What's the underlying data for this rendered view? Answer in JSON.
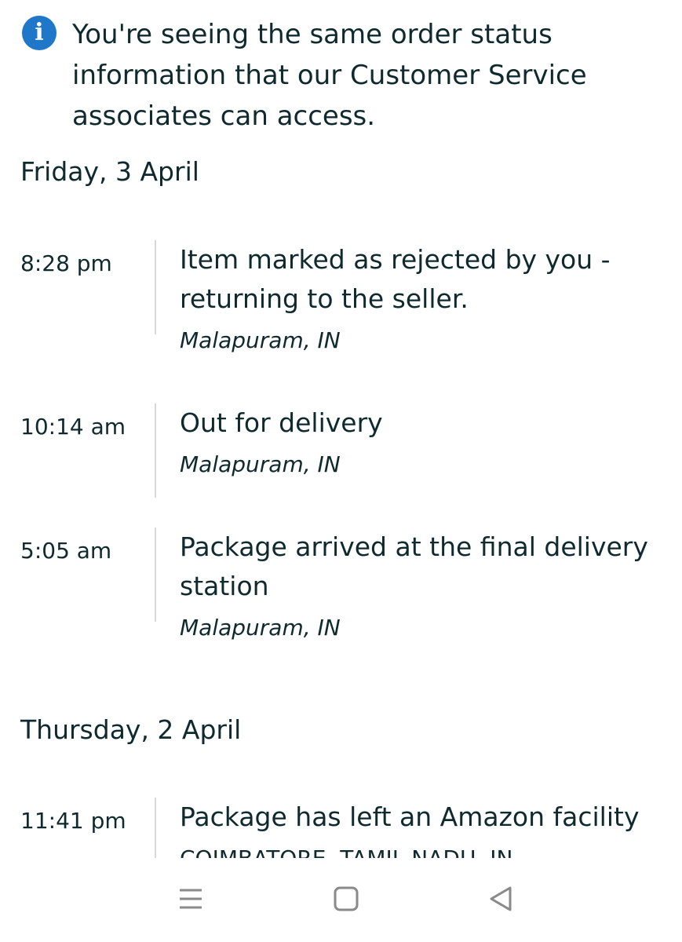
{
  "notice": {
    "icon": "info-icon",
    "icon_glyph": "i",
    "text": "You're seeing the same order status information that our Customer Service associates can access."
  },
  "days": [
    {
      "label": "Friday, 3 April",
      "events": [
        {
          "time": "8:28 pm",
          "status": "Item marked as rejected by you - returning to the seller.",
          "location": "Malapuram, IN"
        },
        {
          "time": "10:14 am",
          "status": "Out for delivery",
          "location": "Malapuram, IN"
        },
        {
          "time": "5:05 am",
          "status": "Package arrived at the final delivery station",
          "location": "Malapuram, IN"
        }
      ]
    },
    {
      "label": "Thursday, 2 April",
      "events": [
        {
          "time": "11:41 pm",
          "status": "Package has left an Amazon facility",
          "location": "COIMBATORE, TAMIL NADU, IN"
        }
      ]
    }
  ],
  "navbar": {
    "recent_icon": "menu-lines-icon",
    "home_icon": "square-home-icon",
    "back_icon": "triangle-back-icon",
    "icon_color": "#8a8a8a"
  },
  "colors": {
    "text": "#0f2a2e",
    "info_icon": "#1f77c9",
    "divider": "#d5d9d9"
  }
}
